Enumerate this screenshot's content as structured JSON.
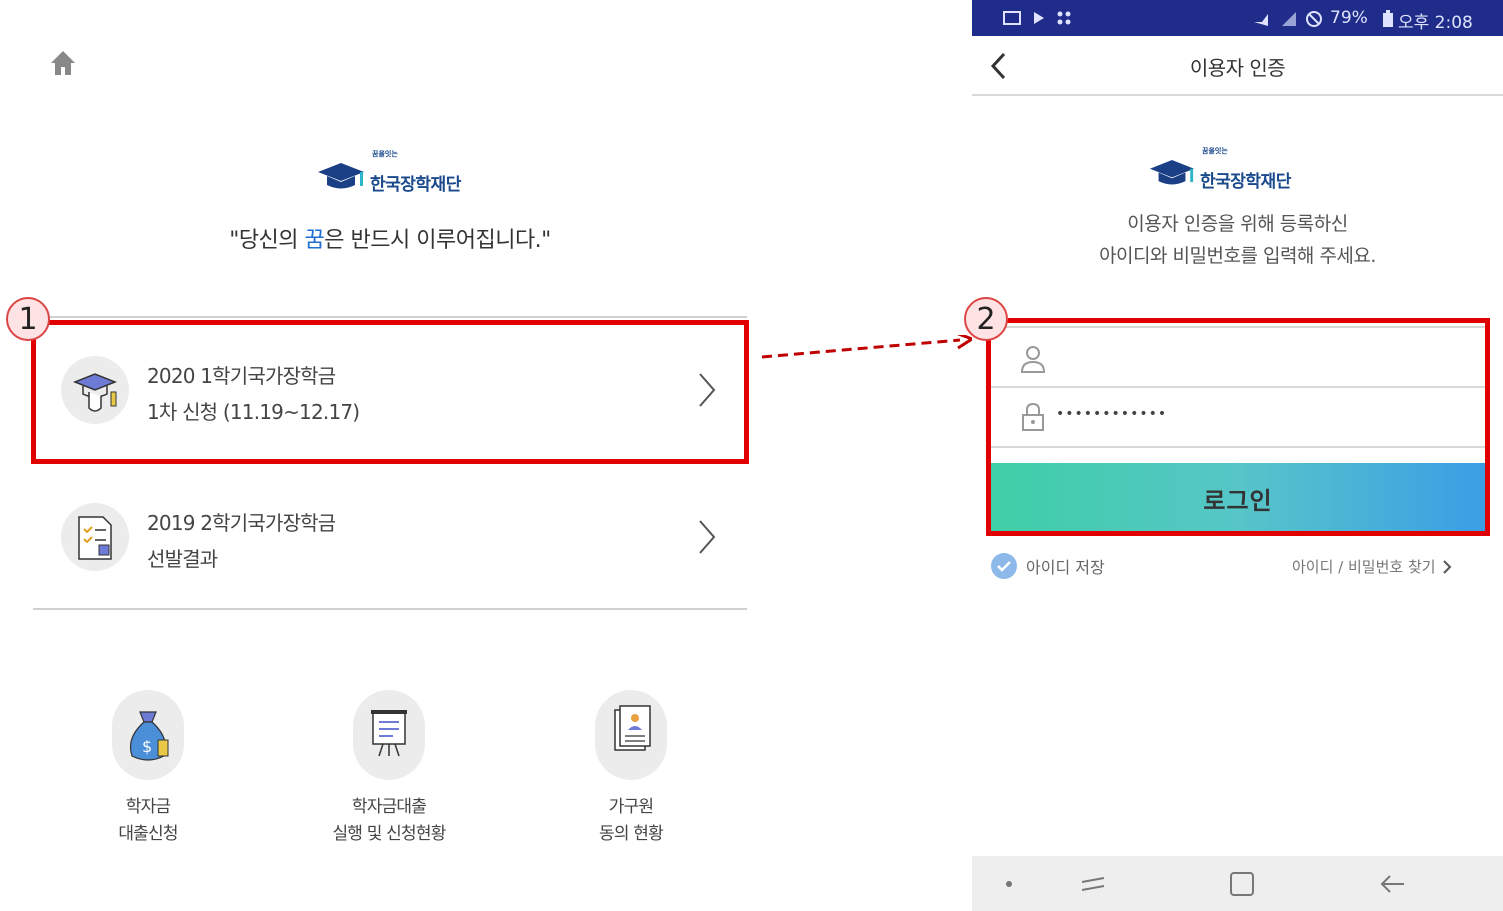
{
  "left": {
    "logo": {
      "sub": "꿈을잇는",
      "name": "한국장학재단"
    },
    "slogan": {
      "before": "\"당신의 ",
      "highlight": "꿈",
      "after": "은 반드시 이루어집니다.\""
    },
    "menu": [
      {
        "line1": "2020 1학기국가장학금",
        "line2": "1차 신청 (11.19~12.17)"
      },
      {
        "line1": "2019 2학기국가장학금",
        "line2": "선발결과"
      }
    ],
    "quick": [
      {
        "line1": "학자금",
        "line2": "대출신청"
      },
      {
        "line1": "학자금대출",
        "line2": "실행 및 신청현황"
      },
      {
        "line1": "가구원",
        "line2": "동의 현황"
      }
    ],
    "step_badge": "1"
  },
  "right": {
    "status": {
      "right": "79%",
      "time": "오후 2:08"
    },
    "appbar_title": "이용자 인증",
    "logo": {
      "sub": "꿈을잇는",
      "name": "한국장학재단"
    },
    "desc": {
      "line1": "이용자 인증을 위해 등록하신",
      "line2": "아이디와 비밀번호를 입력해 주세요."
    },
    "password_mask": "••••••••••••",
    "login_label": "로그인",
    "save_id_label": "아이디 저장",
    "find_label": "아이디 / 비밀번호 찾기",
    "step_badge": "2"
  },
  "colors": {
    "highlight_red": "#e00000",
    "statusbar": "#1f2c8a",
    "brand_blue": "#1a4a8c"
  }
}
